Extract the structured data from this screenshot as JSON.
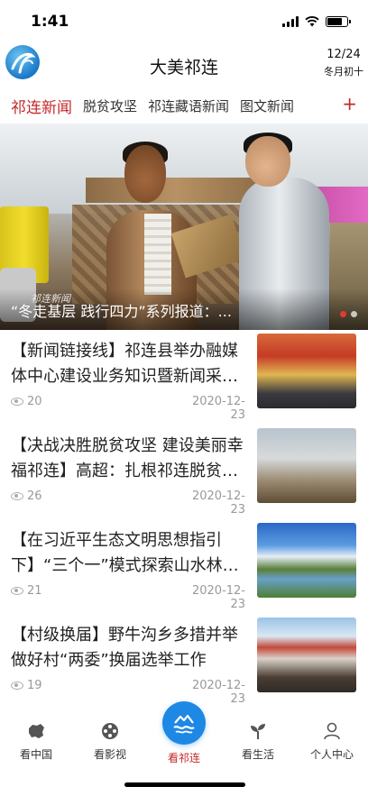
{
  "status_bar": {
    "time": "1:41"
  },
  "header": {
    "title": "大美祁连",
    "date": "12/24",
    "lunar_date": "冬月初十"
  },
  "tabs": [
    {
      "label": "祁连新闻",
      "active": true
    },
    {
      "label": "脱贫攻坚",
      "active": false
    },
    {
      "label": "祁连藏语新闻",
      "active": false
    },
    {
      "label": "图文新闻",
      "active": false
    }
  ],
  "tab_add_label": "+",
  "banner": {
    "caption": "“冬走基层 践行四力”系列报道：...",
    "watermark": "祁连新闻"
  },
  "news": [
    {
      "title": "【新闻链接线】祁连县举办融媒体中心建设业务知识暨新闻采编培训",
      "views": "20",
      "date": "2020-12-23"
    },
    {
      "title": "【决战决胜脱贫攻坚 建设美丽幸福祁连】高超：扎根祁连脱贫一线",
      "views": "26",
      "date": "2020-12-23"
    },
    {
      "title": "【在习近平生态文明思想指引下】“三个一”模式探索山水林田湖草",
      "views": "21",
      "date": "2020-12-23"
    },
    {
      "title": "【村级换届】野牛沟乡多措并举做好村“两委”换届选举工作",
      "views": "19",
      "date": "2020-12-23"
    }
  ],
  "tabbar": [
    {
      "label": "看中国",
      "icon": "china-map-icon"
    },
    {
      "label": "看影视",
      "icon": "film-reel-icon"
    },
    {
      "label": "看祁连",
      "icon": "mountain-wave-icon",
      "active": true
    },
    {
      "label": "看生活",
      "icon": "sprout-icon"
    },
    {
      "label": "个人中心",
      "icon": "person-icon"
    }
  ],
  "colors": {
    "accent_red": "#c62828",
    "accent_blue": "#1e88e5"
  }
}
